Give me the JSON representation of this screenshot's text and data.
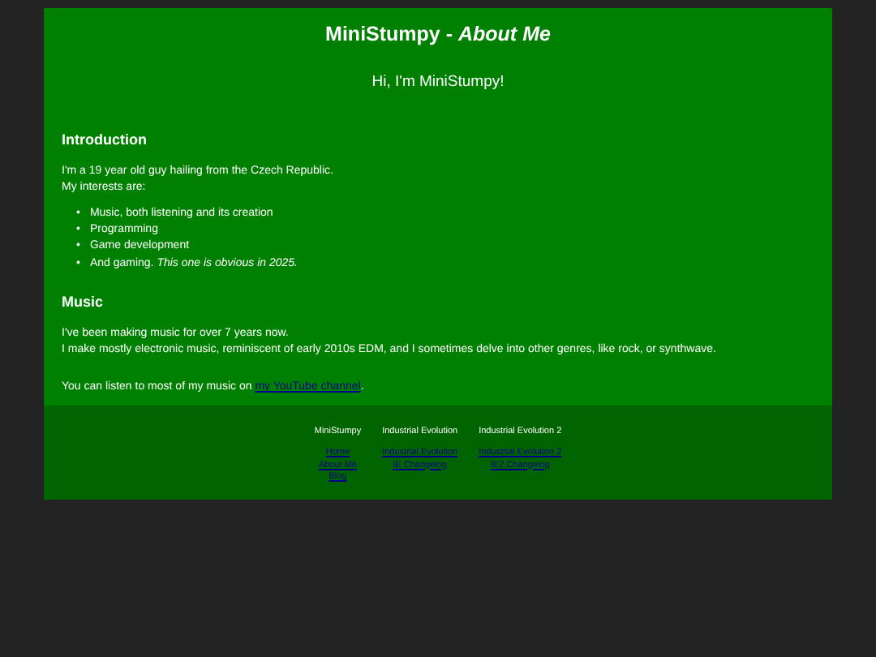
{
  "header": {
    "title": "MiniStumpy - *About Me*",
    "greeting": "Hi, I'm MiniStumpy!"
  },
  "sections": [
    {
      "heading": "Introduction",
      "blocks": [
        {
          "kind": "paragraph",
          "lines": [
            "I'm a 19 year old guy hailing from the Czech Republic.",
            "My interests are:"
          ]
        },
        {
          "kind": "list",
          "marker": "•",
          "items": [
            "Music, both listening and its creation",
            "Programming",
            "Game development",
            "And gaming. *This one is obvious in 2025.*"
          ]
        }
      ]
    },
    {
      "heading": "Music",
      "blocks": [
        {
          "kind": "paragraph",
          "lines": [
            "I've been making music for over 7 years now.",
            "I make mostly electronic music, reminiscent of early 2010s EDM, and I sometimes delve into other genres, like rock, or synthwave."
          ]
        },
        {
          "kind": "link_paragraph",
          "text": "You can listen to most of my music on ",
          "link": "my YouTube channel",
          "after": "."
        }
      ]
    }
  ],
  "footer": {
    "columns": [
      {
        "heading": "MiniStumpy",
        "links": [
          "Home",
          "About Me",
          "Blog"
        ]
      },
      {
        "heading": "Industrial Evolution",
        "links": [
          "Industrial Evolution",
          "IE Changelog"
        ]
      },
      {
        "heading": "Industrial Evolution 2",
        "links": [
          "Industrial Evolution 2",
          "IE2 Changelog"
        ]
      }
    ]
  }
}
